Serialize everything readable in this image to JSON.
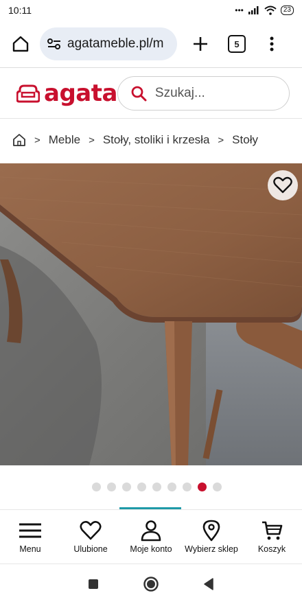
{
  "status": {
    "time": "10:11",
    "signal_dots": "•••",
    "battery": "23"
  },
  "browser": {
    "url": "agatameble.pl/m",
    "tab_count": "5"
  },
  "site": {
    "logo_text": "agata",
    "brand_color": "#c8102e",
    "search_placeholder": "Szukaj..."
  },
  "breadcrumb": {
    "items": [
      "Meble",
      "Stoły, stoliki i krzesła",
      "Stoły"
    ],
    "separator": ">"
  },
  "gallery": {
    "slide_count": 9,
    "active_slide": 8
  },
  "bottom_nav": {
    "items": [
      {
        "label": "Menu",
        "icon": "hamburger-icon"
      },
      {
        "label": "Ulubione",
        "icon": "heart-icon"
      },
      {
        "label": "Moje konto",
        "icon": "user-icon"
      },
      {
        "label": "Wybierz sklep",
        "icon": "location-pin-icon"
      },
      {
        "label": "Koszyk",
        "icon": "cart-icon"
      }
    ],
    "active_indicator_color": "#1f9aa8"
  }
}
